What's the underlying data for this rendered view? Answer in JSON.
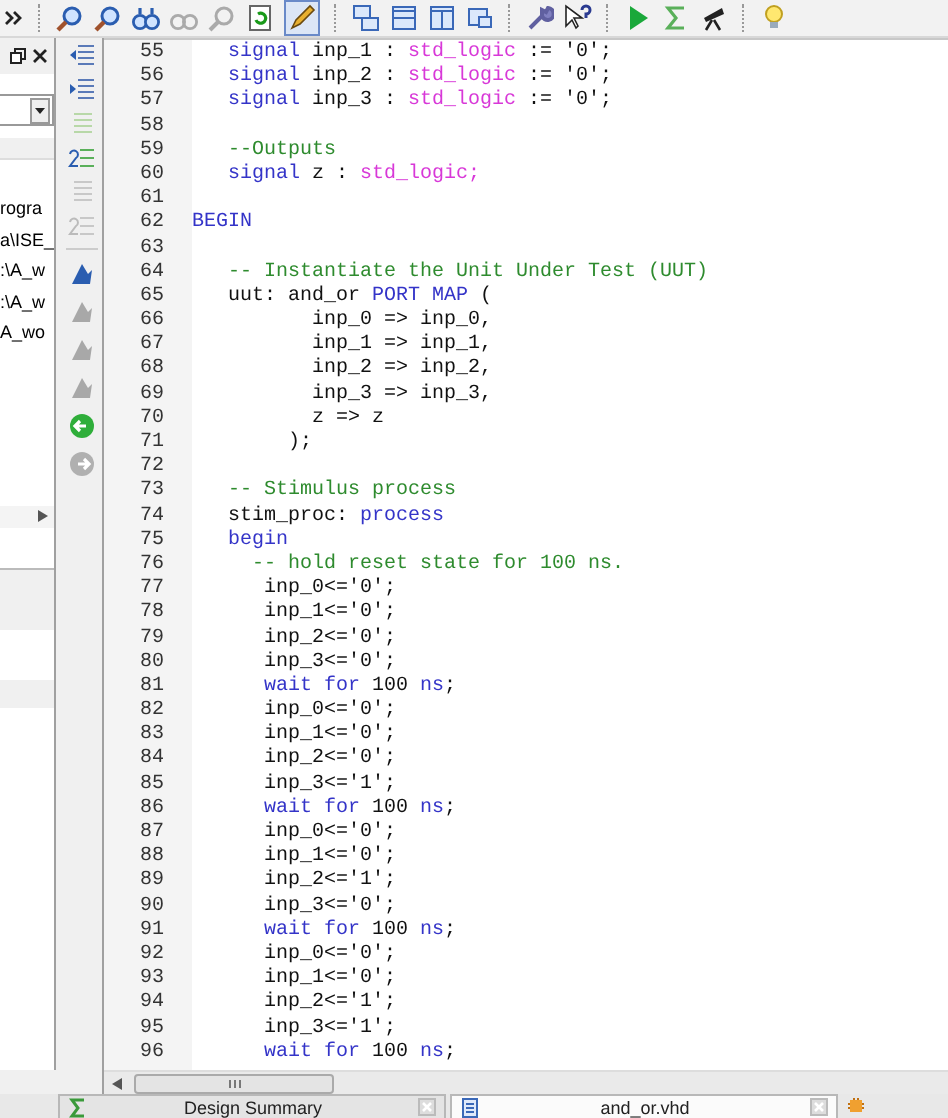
{
  "side_panel": {
    "paths": [
      "rogra",
      "a\\ISE_",
      ":\\A_w",
      ":\\A_w",
      "A_wo"
    ]
  },
  "editor": {
    "lines": [
      {
        "number": "55",
        "tokens": [
          {
            "kind": "kw",
            "text": "   signal"
          },
          {
            "kind": "plain",
            "text": " inp_1 : "
          },
          {
            "kind": "type",
            "text": "std_logic"
          },
          {
            "kind": "plain",
            "text": " := '0';"
          }
        ]
      },
      {
        "number": "56",
        "tokens": [
          {
            "kind": "kw",
            "text": "   signal"
          },
          {
            "kind": "plain",
            "text": " inp_2 : "
          },
          {
            "kind": "type",
            "text": "std_logic"
          },
          {
            "kind": "plain",
            "text": " := '0';"
          }
        ]
      },
      {
        "number": "57",
        "tokens": [
          {
            "kind": "kw",
            "text": "   signal"
          },
          {
            "kind": "plain",
            "text": " inp_3 : "
          },
          {
            "kind": "type",
            "text": "std_logic"
          },
          {
            "kind": "plain",
            "text": " := '0';"
          }
        ]
      },
      {
        "number": "58"
      },
      {
        "number": "59",
        "tokens": [
          {
            "kind": "comment",
            "text": "   --Outputs"
          }
        ]
      },
      {
        "number": "60",
        "tokens": [
          {
            "kind": "kw",
            "text": "   signal"
          },
          {
            "kind": "plain",
            "text": " z : "
          },
          {
            "kind": "type",
            "text": "std_logic;"
          }
        ]
      },
      {
        "number": "61"
      },
      {
        "number": "62",
        "tokens": [
          {
            "kind": "kw",
            "text": "BEGIN"
          }
        ]
      },
      {
        "number": "63"
      },
      {
        "number": "64",
        "tokens": [
          {
            "kind": "comment",
            "text": "   -- Instantiate the Unit Under Test (UUT)"
          }
        ]
      },
      {
        "number": "65",
        "tokens": [
          {
            "kind": "plain",
            "text": "   uut: and_or "
          },
          {
            "kind": "kw",
            "text": "PORT MAP"
          },
          {
            "kind": "plain",
            "text": " ("
          }
        ]
      },
      {
        "number": "66",
        "tokens": [
          {
            "kind": "plain",
            "text": "          inp_0 => inp_0,"
          }
        ]
      },
      {
        "number": "67",
        "tokens": [
          {
            "kind": "plain",
            "text": "          inp_1 => inp_1,"
          }
        ]
      },
      {
        "number": "68",
        "tokens": [
          {
            "kind": "plain",
            "text": "          inp_2 => inp_2,"
          }
        ]
      },
      {
        "number": "69",
        "tokens": [
          {
            "kind": "plain",
            "text": "          inp_3 => inp_3,"
          }
        ]
      },
      {
        "number": "70",
        "tokens": [
          {
            "kind": "plain",
            "text": "          z => z"
          }
        ]
      },
      {
        "number": "71",
        "tokens": [
          {
            "kind": "plain",
            "text": "        );"
          }
        ]
      },
      {
        "number": "72"
      },
      {
        "number": "73",
        "tokens": [
          {
            "kind": "comment",
            "text": "   -- Stimulus process"
          }
        ]
      },
      {
        "number": "74",
        "tokens": [
          {
            "kind": "plain",
            "text": "   stim_proc: "
          },
          {
            "kind": "kw",
            "text": "process"
          }
        ]
      },
      {
        "number": "75",
        "tokens": [
          {
            "kind": "kw",
            "text": "   begin"
          }
        ]
      },
      {
        "number": "76",
        "tokens": [
          {
            "kind": "comment",
            "text": "     -- hold reset state for 100 ns."
          }
        ]
      },
      {
        "number": "77",
        "tokens": [
          {
            "kind": "plain",
            "text": "      inp_0<='0';"
          }
        ]
      },
      {
        "number": "78",
        "tokens": [
          {
            "kind": "plain",
            "text": "      inp_1<='0';"
          }
        ]
      },
      {
        "number": "79",
        "tokens": [
          {
            "kind": "plain",
            "text": "      inp_2<='0';"
          }
        ]
      },
      {
        "number": "80",
        "tokens": [
          {
            "kind": "plain",
            "text": "      inp_3<='0';"
          }
        ]
      },
      {
        "number": "81",
        "tokens": [
          {
            "kind": "kw",
            "text": "      wait for"
          },
          {
            "kind": "plain",
            "text": " 100 "
          },
          {
            "kind": "kw",
            "text": "ns"
          },
          {
            "kind": "plain",
            "text": ";"
          }
        ]
      },
      {
        "number": "82",
        "tokens": [
          {
            "kind": "plain",
            "text": "      inp_0<='0';"
          }
        ]
      },
      {
        "number": "83",
        "tokens": [
          {
            "kind": "plain",
            "text": "      inp_1<='0';"
          }
        ]
      },
      {
        "number": "84",
        "tokens": [
          {
            "kind": "plain",
            "text": "      inp_2<='0';"
          }
        ]
      },
      {
        "number": "85",
        "tokens": [
          {
            "kind": "plain",
            "text": "      inp_3<='1';"
          }
        ]
      },
      {
        "number": "86",
        "tokens": [
          {
            "kind": "kw",
            "text": "      wait for"
          },
          {
            "kind": "plain",
            "text": " 100 "
          },
          {
            "kind": "kw",
            "text": "ns"
          },
          {
            "kind": "plain",
            "text": ";"
          }
        ]
      },
      {
        "number": "87",
        "tokens": [
          {
            "kind": "plain",
            "text": "      inp_0<='0';"
          }
        ]
      },
      {
        "number": "88",
        "tokens": [
          {
            "kind": "plain",
            "text": "      inp_1<='0';"
          }
        ]
      },
      {
        "number": "89",
        "tokens": [
          {
            "kind": "plain",
            "text": "      inp_2<='1';"
          }
        ]
      },
      {
        "number": "90",
        "tokens": [
          {
            "kind": "plain",
            "text": "      inp_3<='0';"
          }
        ]
      },
      {
        "number": "91",
        "tokens": [
          {
            "kind": "kw",
            "text": "      wait for"
          },
          {
            "kind": "plain",
            "text": " 100 "
          },
          {
            "kind": "kw",
            "text": "ns"
          },
          {
            "kind": "plain",
            "text": ";"
          }
        ]
      },
      {
        "number": "92",
        "tokens": [
          {
            "kind": "plain",
            "text": "      inp_0<='0';"
          }
        ]
      },
      {
        "number": "93",
        "tokens": [
          {
            "kind": "plain",
            "text": "      inp_1<='0';"
          }
        ]
      },
      {
        "number": "94",
        "tokens": [
          {
            "kind": "plain",
            "text": "      inp_2<='1';"
          }
        ]
      },
      {
        "number": "95",
        "tokens": [
          {
            "kind": "plain",
            "text": "      inp_3<='1';"
          }
        ]
      },
      {
        "number": "96",
        "tokens": [
          {
            "kind": "kw",
            "text": "      wait for"
          },
          {
            "kind": "plain",
            "text": " 100 "
          },
          {
            "kind": "kw",
            "text": "ns"
          },
          {
            "kind": "plain",
            "text": ";"
          }
        ]
      }
    ]
  },
  "tabs": [
    {
      "label": "Design Summary",
      "kind": "summary",
      "selected": false
    },
    {
      "label": "and_or.vhd",
      "kind": "file",
      "selected": true
    }
  ]
}
